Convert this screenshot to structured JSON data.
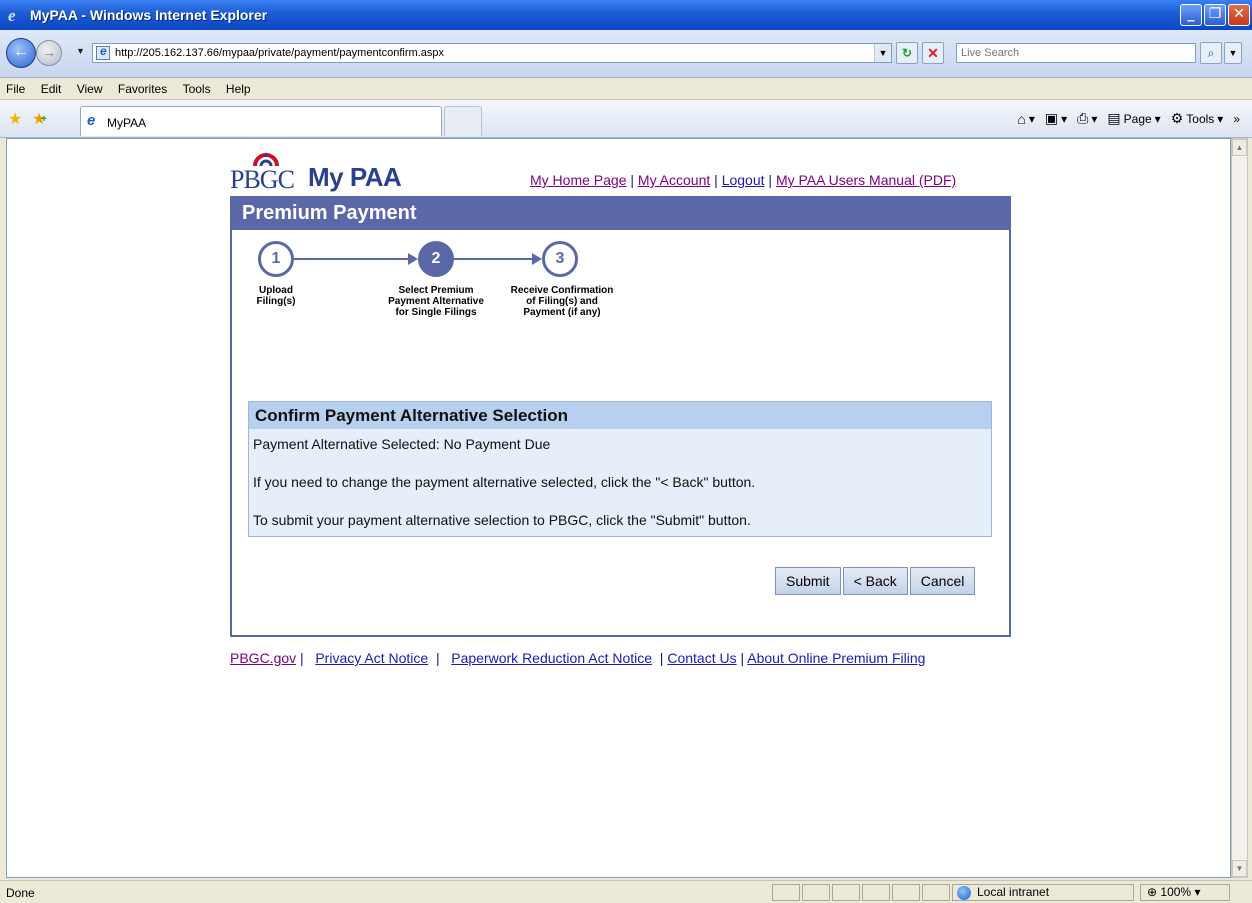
{
  "window": {
    "title": "MyPAA - Windows Internet Explorer"
  },
  "address_bar": {
    "url": "http://205.162.137.66/mypaa/private/payment/paymentconfirm.aspx",
    "search_placeholder": "Live Search"
  },
  "menu": {
    "items": [
      "File",
      "Edit",
      "View",
      "Favorites",
      "Tools",
      "Help"
    ]
  },
  "tabs": {
    "active_label": "MyPAA"
  },
  "command_bar": {
    "page_label": "Page",
    "tools_label": "Tools"
  },
  "header": {
    "logo_pbgc": "PBGC",
    "logo_mypaa": "My PAA",
    "links": {
      "home": "My Home Page",
      "account": "My Account",
      "logout": "Logout",
      "manual": "My PAA Users Manual (PDF)"
    }
  },
  "panel": {
    "title": "Premium Payment"
  },
  "steps": [
    {
      "number": "1",
      "label_line1": "Upload",
      "label_line2": "Filing(s)",
      "label_line3": ""
    },
    {
      "number": "2",
      "label_line1": "Select Premium",
      "label_line2": "Payment Alternative",
      "label_line3": "for Single Filings"
    },
    {
      "number": "3",
      "label_line1": "Receive Confirmation",
      "label_line2": "of Filing(s) and",
      "label_line3": "Payment (if any)"
    }
  ],
  "confirm": {
    "title": "Confirm Payment Alternative Selection",
    "selected": "Payment Alternative Selected: No Payment Due",
    "back_hint": "If you need to change the payment alternative selected, click the \"< Back\" button.",
    "submit_hint": "To submit your payment alternative selection to PBGC, click the \"Submit\" button."
  },
  "buttons": {
    "submit": "Submit",
    "back": "< Back",
    "cancel": "Cancel"
  },
  "footer": {
    "pbgc": "PBGC.gov",
    "privacy": "Privacy Act Notice",
    "paperwork": "Paperwork Reduction Act Notice",
    "contact": "Contact Us",
    "about": "About Online Premium Filing"
  },
  "status": {
    "text": "Done",
    "zone": "Local intranet",
    "zoom": "100%"
  }
}
